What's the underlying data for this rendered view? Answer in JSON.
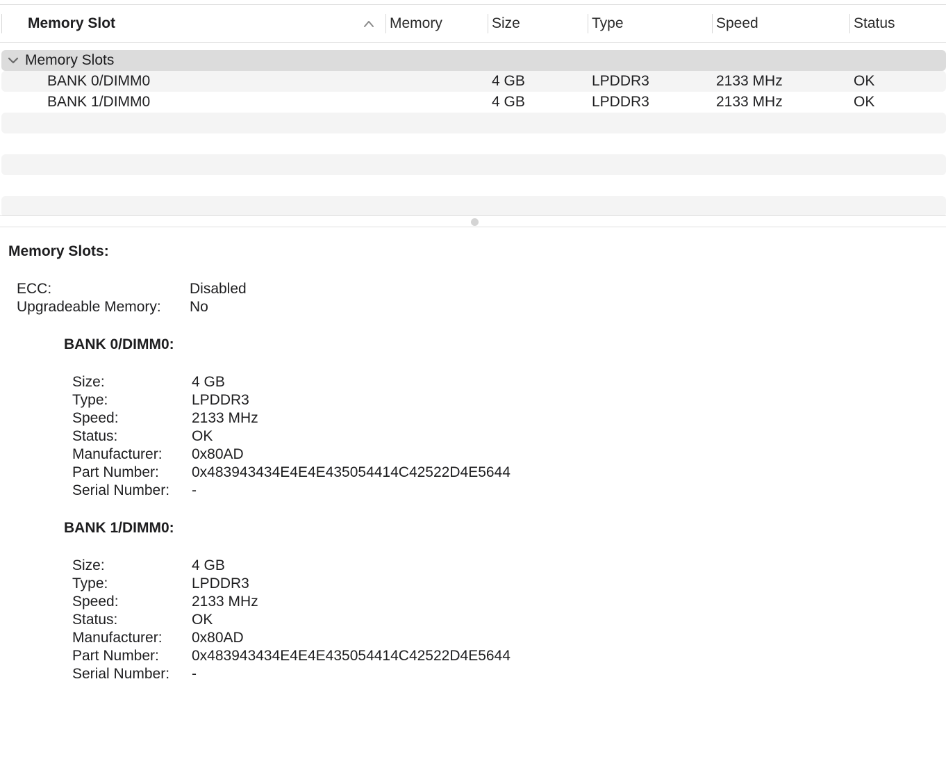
{
  "table": {
    "columns": {
      "memory_slot": "Memory Slot",
      "memory": "Memory",
      "size": "Size",
      "type": "Type",
      "speed": "Speed",
      "status": "Status"
    },
    "sort_icon": "chevron-up-icon",
    "group": {
      "label": "Memory Slots",
      "icon": "chevron-down-icon"
    },
    "rows": [
      {
        "slot": "BANK 0/DIMM0",
        "memory": "",
        "size": "4 GB",
        "type": "LPDDR3",
        "speed": "2133 MHz",
        "status": "OK"
      },
      {
        "slot": "BANK 1/DIMM0",
        "memory": "",
        "size": "4 GB",
        "type": "LPDDR3",
        "speed": "2133 MHz",
        "status": "OK"
      }
    ]
  },
  "detail": {
    "title": "Memory Slots:",
    "ecc_label": "ECC:",
    "ecc_value": "Disabled",
    "upgradeable_label": "Upgradeable Memory:",
    "upgradeable_value": "No",
    "banks": [
      {
        "title": "BANK 0/DIMM0:",
        "size_label": "Size:",
        "size": "4 GB",
        "type_label": "Type:",
        "type": "LPDDR3",
        "speed_label": "Speed:",
        "speed": "2133 MHz",
        "status_label": "Status:",
        "status": "OK",
        "manufacturer_label": "Manufacturer:",
        "manufacturer": "0x80AD",
        "part_label": "Part Number:",
        "part": "0x483943434E4E4E435054414C42522D4E5644",
        "serial_label": "Serial Number:",
        "serial": "-"
      },
      {
        "title": "BANK 1/DIMM0:",
        "size_label": "Size:",
        "size": "4 GB",
        "type_label": "Type:",
        "type": "LPDDR3",
        "speed_label": "Speed:",
        "speed": "2133 MHz",
        "status_label": "Status:",
        "status": "OK",
        "manufacturer_label": "Manufacturer:",
        "manufacturer": "0x80AD",
        "part_label": "Part Number:",
        "part": "0x483943434E4E4E435054414C42522D4E5644",
        "serial_label": "Serial Number:",
        "serial": "-"
      }
    ]
  }
}
